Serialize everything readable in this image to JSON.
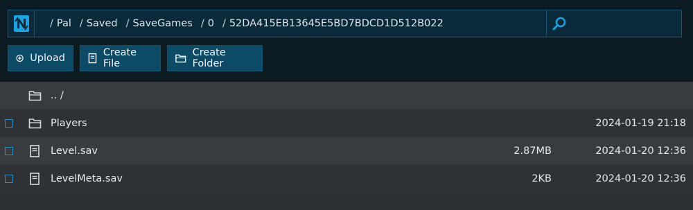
{
  "breadcrumb": [
    "Pal",
    "Saved",
    "SaveGames",
    "0",
    "52DA415EB13645E5BD7BDCD1D512B022"
  ],
  "breadcrumb_separator": "/",
  "toolbar": {
    "upload_label": "Upload",
    "create_file_label": "Create File",
    "create_folder_label": "Create Folder"
  },
  "files": {
    "parent": {
      "name": ".. /"
    },
    "items": [
      {
        "name": "Players",
        "size": "",
        "date": "2024-01-19 21:18",
        "type": "folder"
      },
      {
        "name": "Level.sav",
        "size": "2.87MB",
        "date": "2024-01-20 12:36",
        "type": "file"
      },
      {
        "name": "LevelMeta.sav",
        "size": "2KB",
        "date": "2024-01-20 12:36",
        "type": "file"
      }
    ]
  },
  "colors": {
    "accent": "#0d4a66",
    "checkbox": "#2a8fc4",
    "logo": "#1fa3e0"
  },
  "icons": {
    "logo": "app-logo-icon",
    "search": "search-icon",
    "upload": "plus-circle-icon",
    "create_file": "file-icon",
    "create_folder": "folder-icon"
  }
}
